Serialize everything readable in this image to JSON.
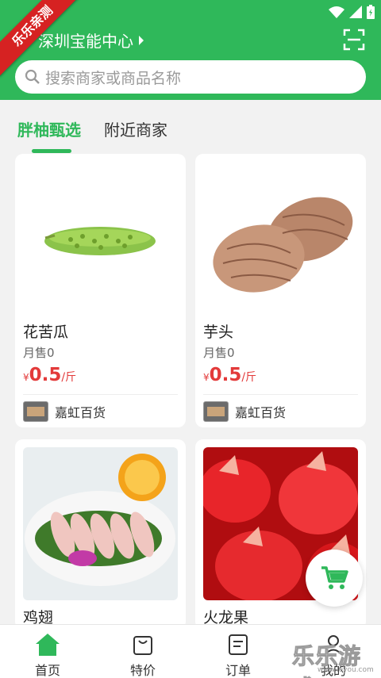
{
  "status_bar": {
    "wifi_icon": "wifi-icon",
    "signal_icon": "signal-icon",
    "battery_icon": "battery-icon"
  },
  "header": {
    "location": "深圳宝能中心",
    "search_placeholder": "搜索商家或商品名称",
    "brand_color": "#2fb85a"
  },
  "ribbon": "乐乐亲测",
  "tabs": [
    {
      "label": "胖柚甄选",
      "active": true
    },
    {
      "label": "附近商家",
      "active": false
    }
  ],
  "products": [
    {
      "name": "花苦瓜",
      "sold": "月售0",
      "currency": "¥",
      "price": "0.5",
      "unit": "/斤",
      "shop": "嘉虹百货"
    },
    {
      "name": "芋头",
      "sold": "月售0",
      "currency": "¥",
      "price": "0.5",
      "unit": "/斤",
      "shop": "嘉虹百货"
    },
    {
      "name": "鸡翅",
      "sold": "",
      "shop": ""
    },
    {
      "name": "火龙果",
      "sold": "",
      "shop": ""
    }
  ],
  "bottom_nav": [
    {
      "label": "首页",
      "icon": "home-icon",
      "active": true
    },
    {
      "label": "特价",
      "icon": "bag-icon",
      "active": false
    },
    {
      "label": "订单",
      "icon": "order-icon",
      "active": false
    },
    {
      "label": "我的",
      "icon": "user-icon",
      "active": false
    }
  ],
  "watermark": {
    "text": "乐乐游戏",
    "sub": "www.leyou.com"
  },
  "price_color": "#e33a3a"
}
